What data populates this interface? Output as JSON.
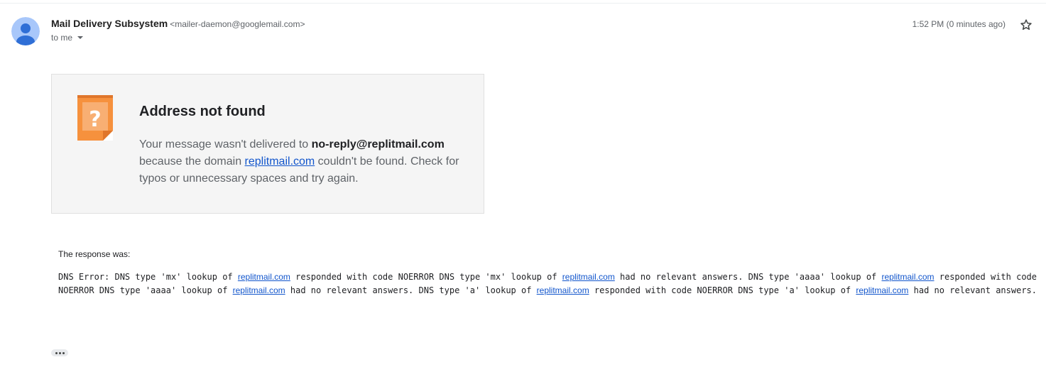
{
  "message": {
    "sender_name": "Mail Delivery Subsystem",
    "sender_email": "<mailer-daemon@googlemail.com>",
    "recipient_label": "to me",
    "timestamp": "1:52 PM (0 minutes ago)",
    "icons": {
      "avatar": "person-avatar",
      "star": "star-outline-icon",
      "recipient_menu": "caret-down-icon"
    }
  },
  "notice": {
    "icon": "question-mark-warning-icon",
    "icon_color": "#F6913D",
    "title": "Address not found",
    "body_prefix": "Your message wasn't delivered to ",
    "address": "no-reply@replitmail.com",
    "body_middle": " because the domain ",
    "domain_link": "replitmail.com",
    "body_suffix": " couldn't be found. Check for typos or unnecessary spaces and try again."
  },
  "response": {
    "label": "The response was:",
    "lines": [
      [
        {
          "text": "DNS Error: DNS type 'mx' lookup of "
        },
        {
          "text": "replitmail.com",
          "link": true
        },
        {
          "text": " responded with code NOERROR DNS type 'mx' lookup of "
        },
        {
          "text": "replitmail.com",
          "link": true
        },
        {
          "text": " had no relevant answers. DNS type 'aaaa' lookup of "
        },
        {
          "text": "replitmail.com",
          "link": true
        },
        {
          "text": " responded with code"
        }
      ],
      [
        {
          "text": "NOERROR DNS type 'aaaa' lookup of "
        },
        {
          "text": "replitmail.com",
          "link": true
        },
        {
          "text": " had no relevant answers. DNS type 'a' lookup of "
        },
        {
          "text": "replitmail.com",
          "link": true
        },
        {
          "text": " responded with code NOERROR DNS type 'a' lookup of "
        },
        {
          "text": "replitmail.com",
          "link": true
        },
        {
          "text": " had no relevant answers."
        }
      ]
    ]
  },
  "colors": {
    "link": "#1155cc",
    "card_background": "#f5f5f5",
    "avatar": "#a8c7fa"
  },
  "footer": {
    "show_trimmed_icon": "ellipsis-icon"
  }
}
